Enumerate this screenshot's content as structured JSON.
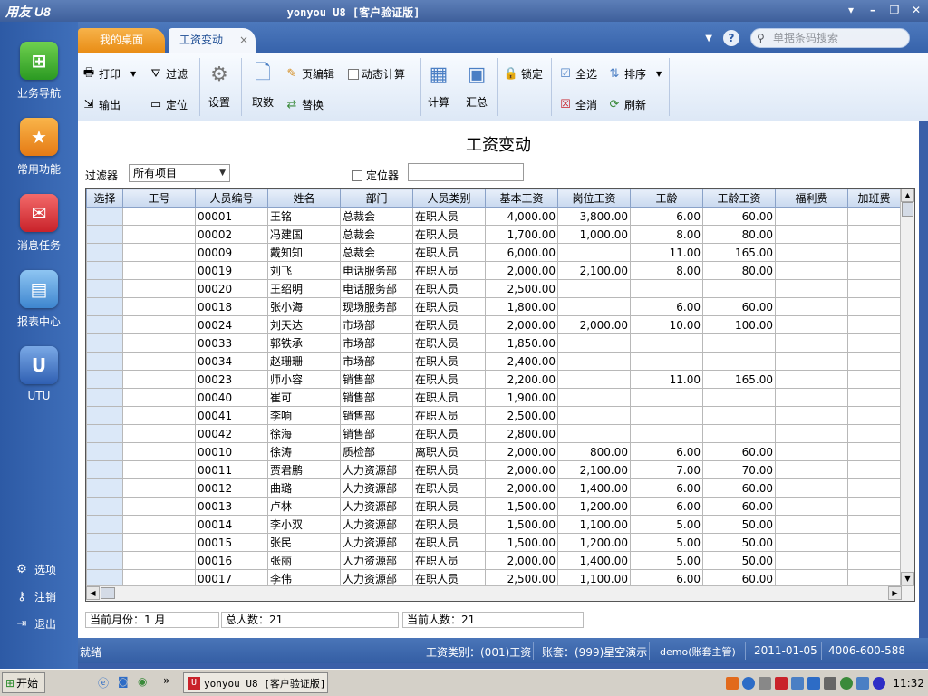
{
  "app": {
    "logo": "用友 U8",
    "window_title": "yonyou U8 [客户验证版]"
  },
  "sidebar": {
    "items": [
      {
        "label": "业务导航"
      },
      {
        "label": "常用功能"
      },
      {
        "label": "消息任务"
      },
      {
        "label": "报表中心"
      },
      {
        "label": "UTU"
      }
    ],
    "links": [
      {
        "label": "选项"
      },
      {
        "label": "注销"
      },
      {
        "label": "退出"
      }
    ]
  },
  "tabs": [
    {
      "label": "我的桌面"
    },
    {
      "label": "工资变动"
    }
  ],
  "search": {
    "placeholder": "单据条码搜索"
  },
  "toolbar": {
    "print": "打印",
    "filter": "过滤",
    "export": "输出",
    "locate": "定位",
    "settings": "设置",
    "fetch": "取数",
    "page_edit": "页编辑",
    "replace": "替换",
    "dynamic_calc": "动态计算",
    "calculate": "计算",
    "summary": "汇总",
    "lock": "锁定",
    "select_all": "全选",
    "deselect_all": "全消",
    "sort": "排序",
    "refresh": "刷新"
  },
  "page": {
    "title": "工资变动",
    "filter_label": "过滤器",
    "filter_value": "所有项目",
    "locator_label": "定位器"
  },
  "table": {
    "columns": [
      "选择",
      "工号",
      "人员编号",
      "姓名",
      "部门",
      "人员类别",
      "基本工资",
      "岗位工资",
      "工龄",
      "工龄工资",
      "福利费",
      "加班费"
    ],
    "rows": [
      [
        "",
        "",
        "00001",
        "王铭",
        "总裁会",
        "在职人员",
        "4,000.00",
        "3,800.00",
        "6.00",
        "60.00",
        "",
        ""
      ],
      [
        "",
        "",
        "00002",
        "冯建国",
        "总裁会",
        "在职人员",
        "1,700.00",
        "1,000.00",
        "8.00",
        "80.00",
        "",
        ""
      ],
      [
        "",
        "",
        "00009",
        "戴知知",
        "总裁会",
        "在职人员",
        "6,000.00",
        "",
        "11.00",
        "165.00",
        "",
        ""
      ],
      [
        "",
        "",
        "00019",
        "刘飞",
        "电话服务部",
        "在职人员",
        "2,000.00",
        "2,100.00",
        "8.00",
        "80.00",
        "",
        ""
      ],
      [
        "",
        "",
        "00020",
        "王绍明",
        "电话服务部",
        "在职人员",
        "2,500.00",
        "",
        "",
        "",
        "",
        ""
      ],
      [
        "",
        "",
        "00018",
        "张小海",
        "现场服务部",
        "在职人员",
        "1,800.00",
        "",
        "6.00",
        "60.00",
        "",
        ""
      ],
      [
        "",
        "",
        "00024",
        "刘天达",
        "市场部",
        "在职人员",
        "2,000.00",
        "2,000.00",
        "10.00",
        "100.00",
        "",
        ""
      ],
      [
        "",
        "",
        "00033",
        "郭铁承",
        "市场部",
        "在职人员",
        "1,850.00",
        "",
        "",
        "",
        "",
        ""
      ],
      [
        "",
        "",
        "00034",
        "赵珊珊",
        "市场部",
        "在职人员",
        "2,400.00",
        "",
        "",
        "",
        "",
        ""
      ],
      [
        "",
        "",
        "00023",
        "师小容",
        "销售部",
        "在职人员",
        "2,200.00",
        "",
        "11.00",
        "165.00",
        "",
        ""
      ],
      [
        "",
        "",
        "00040",
        "崔可",
        "销售部",
        "在职人员",
        "1,900.00",
        "",
        "",
        "",
        "",
        ""
      ],
      [
        "",
        "",
        "00041",
        "李响",
        "销售部",
        "在职人员",
        "2,500.00",
        "",
        "",
        "",
        "",
        ""
      ],
      [
        "",
        "",
        "00042",
        "徐海",
        "销售部",
        "在职人员",
        "2,800.00",
        "",
        "",
        "",
        "",
        ""
      ],
      [
        "",
        "",
        "00010",
        "徐涛",
        "质检部",
        "离职人员",
        "2,000.00",
        "800.00",
        "6.00",
        "60.00",
        "",
        ""
      ],
      [
        "",
        "",
        "00011",
        "贾君鹏",
        "人力资源部",
        "在职人员",
        "2,000.00",
        "2,100.00",
        "7.00",
        "70.00",
        "",
        ""
      ],
      [
        "",
        "",
        "00012",
        "曲璐",
        "人力资源部",
        "在职人员",
        "2,000.00",
        "1,400.00",
        "6.00",
        "60.00",
        "",
        ""
      ],
      [
        "",
        "",
        "00013",
        "卢林",
        "人力资源部",
        "在职人员",
        "1,500.00",
        "1,200.00",
        "6.00",
        "60.00",
        "",
        ""
      ],
      [
        "",
        "",
        "00014",
        "李小双",
        "人力资源部",
        "在职人员",
        "1,500.00",
        "1,100.00",
        "5.00",
        "50.00",
        "",
        ""
      ],
      [
        "",
        "",
        "00015",
        "张民",
        "人力资源部",
        "在职人员",
        "1,500.00",
        "1,200.00",
        "5.00",
        "50.00",
        "",
        ""
      ],
      [
        "",
        "",
        "00016",
        "张丽",
        "人力资源部",
        "在职人员",
        "2,000.00",
        "1,400.00",
        "5.00",
        "50.00",
        "",
        ""
      ],
      [
        "",
        "",
        "00017",
        "李伟",
        "人力资源部",
        "在职人员",
        "2,500.00",
        "1,100.00",
        "6.00",
        "60.00",
        "",
        ""
      ]
    ]
  },
  "footer": {
    "month": "当前月份：1 月",
    "total": "总人数：21",
    "current": "当前人数：21"
  },
  "status": {
    "ready": "就绪",
    "payroll_type": "工资类别：(001)工资",
    "account": "账套：(999)星空演示",
    "user": "demo(账套主管)",
    "date": "2011-01-05",
    "phone": "4006-600-588"
  },
  "taskbar": {
    "start": "开始",
    "app": "yonyou U8 [客户验证版]",
    "clock": "11:32"
  },
  "colors": {
    "accent_orange": "#e98d16",
    "frame_blue": "#3763ab"
  }
}
